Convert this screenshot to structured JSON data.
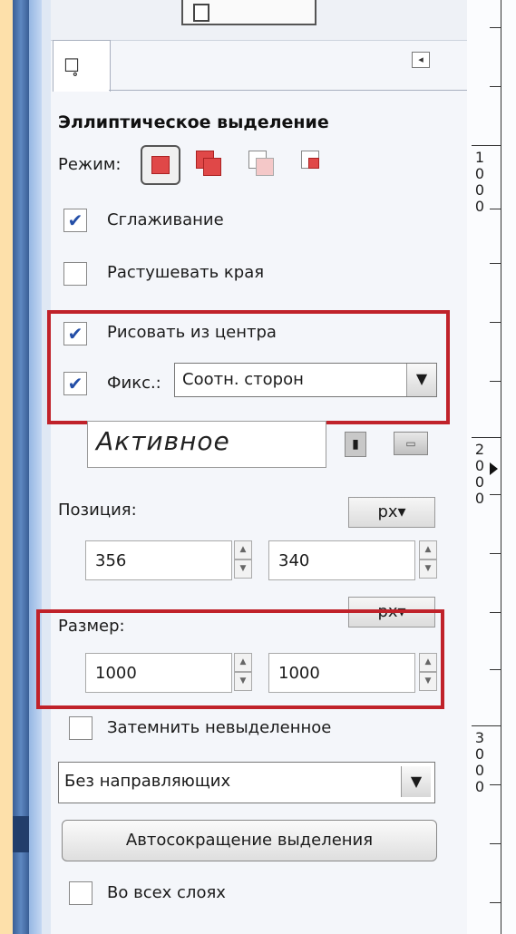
{
  "tab": {
    "icon": "tool-options-icon",
    "icon_glyph": "☐̥"
  },
  "menu_arrow": "◂",
  "tool_title": "Эллиптическое выделение",
  "mode": {
    "label": "Режим:",
    "options": [
      "replace",
      "add",
      "subtract",
      "intersect"
    ],
    "selected": "replace"
  },
  "antialias": {
    "label": "Сглаживание",
    "checked": true
  },
  "feather": {
    "label": "Растушевать края",
    "checked": false
  },
  "expand_center": {
    "label": "Рисовать из центра",
    "checked": true
  },
  "fixed": {
    "label": "Фикс.:",
    "checked": true,
    "value": "Соотн. сторон"
  },
  "active_field": {
    "value": "Активное"
  },
  "position": {
    "label": "Позиция:",
    "unit": "px",
    "x": "356",
    "y": "340"
  },
  "size": {
    "label": "Размер:",
    "unit": "px",
    "w": "1000",
    "h": "1000"
  },
  "highlight_unselected": {
    "label": "Затемнить невыделенное",
    "checked": false
  },
  "guides": {
    "value": "Без направляющих"
  },
  "autoshrink": {
    "label": "Автосокращение выделения"
  },
  "all_layers": {
    "label": "Во всех слоях",
    "checked": false
  },
  "ruler": {
    "labels": [
      [
        "1",
        "0",
        "0",
        "0"
      ],
      [
        "2",
        "0",
        "0",
        "0"
      ],
      [
        "3",
        "0",
        "0",
        "0"
      ]
    ]
  },
  "colors": {
    "highlight": "#c0222a",
    "mode_active": "#e04848",
    "check": "#234ea7"
  }
}
